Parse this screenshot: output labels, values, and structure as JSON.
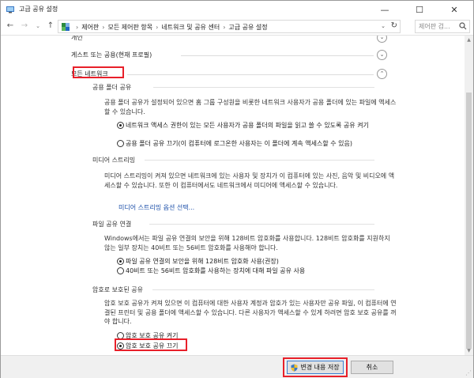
{
  "window": {
    "title": "고급 공유 설정",
    "min_glyph": "—",
    "max_glyph": "☐",
    "close_glyph": "✕"
  },
  "address": {
    "crumbs": [
      "제어판",
      "모든 제어판 항목",
      "네트워크 및 공유 센터",
      "고급 공유 설정"
    ],
    "separator": "›",
    "search_placeholder": "제어판 검..."
  },
  "profiles": {
    "prev_label": "개인",
    "guest_label": "게스트 또는 공용(현재 프로필)",
    "all_label": "모든 네트워크"
  },
  "public_folder": {
    "heading": "공용 폴더 공유",
    "desc": "공용 폴더 공유가 설정되어 있으면 홈 그룹 구성원을 비롯한 네트워크 사용자가 공용 폴더에 있는 파일에 액세스할 수 있습니다.",
    "option_on": "네트워크 액세스 권한이 있는 모든 사용자가 공용 폴더의 파일을 읽고 쓸 수 있도록 공유 켜기",
    "option_off": "공용 폴더 공유 끄기(이 컴퓨터에 로그온한 사용자는 이 폴더에 계속 액세스할 수 있음)"
  },
  "media": {
    "heading": "미디어 스트리밍",
    "desc": "미디어 스트리밍이 켜져 있으면 네트워크에 있는 사용자 및 장치가 이 컴퓨터에 있는 사진, 음악 및 비디오에 액세스할 수 있습니다. 또한 이 컴퓨터에서도 네트워크에서 미디어에 액세스할 수 있습니다.",
    "link": "미디어 스트리밍 옵션 선택..."
  },
  "file_sharing": {
    "heading": "파일 공유 연결",
    "desc": "Windows에서는 파일 공유 연결의 보안을 위해 128비트 암호화를 사용합니다. 128비트 암호화를 지원하지 않는 일부 장치는 40비트 또는 56비트 암호화를 사용해야 합니다.",
    "option_128": "파일 공유 연결의 보안을 위해 128비트 암호화 사용(권장)",
    "option_40": "40비트 또는 56비트 암호화를 사용하는 장치에 대해 파일 공유 사용"
  },
  "password": {
    "heading": "암호로 보호된 공유",
    "desc": "암호 보호 공유가 켜져 있으면 이 컴퓨터에 대한 사용자 계정과 암호가 있는 사용자만 공유 파일, 이 컴퓨터에 연결된 프린터 및 공용 폴더에 액세스할 수 있습니다. 다른 사용자가 액세스할 수 있게 하려면 암호 보호 공유를 꺼야 합니다.",
    "option_on": "암호 보호 공유 켜기",
    "option_off": "암호 보호 공유 끄기"
  },
  "footer": {
    "save_label": "변경 내용 저장",
    "cancel_label": "취소"
  },
  "colors": {
    "highlight_box": "#e8202a",
    "link": "#1a4ea8"
  }
}
